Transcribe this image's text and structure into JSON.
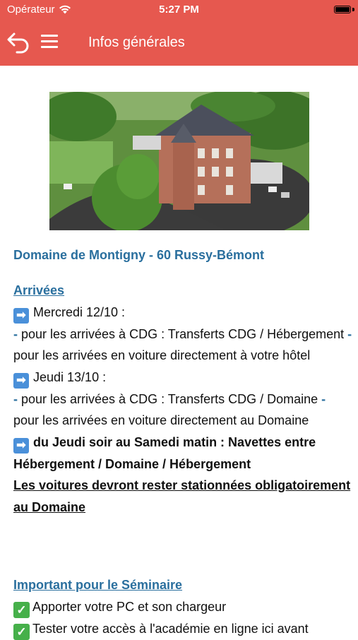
{
  "status_bar": {
    "carrier": "Opérateur",
    "time": "5:27 PM"
  },
  "navbar": {
    "title": "Infos générales",
    "back_icon": "back-arrow-icon",
    "menu_icon": "hamburger-menu-icon"
  },
  "colors": {
    "accent": "#e6584f",
    "link": "#2a6f9e"
  },
  "venue_title": "Domaine de Montigny - 60 Russy-Bémont",
  "arrivals": {
    "heading": "Arrivées",
    "day1": "Mercredi 12/10 :",
    "day1_line1_dash": "-",
    "day1_line1": " pour les arrivées à CDG : Transferts CDG / Hébergement ",
    "day1_line2_dash": "-",
    "day1_line2": " pour les arrivées en voiture directement à votre hôtel",
    "day2": "Jeudi 13/10 :",
    "day2_line1_dash": "-",
    "day2_line1": " pour les arrivées à CDG : Transferts CDG / Domaine ",
    "day2_line2_dash": "-",
    "day2_line2": " pour les arrivées en voiture directement au Domaine",
    "shuttle": "du Jeudi soir au Samedi matin : Navettes entre Hébergement / Domaine / Hébergement",
    "parking": "Les voitures devront rester stationnées obligatoirement au Domaine"
  },
  "seminar": {
    "heading": "Important pour le Séminaire",
    "item1": "Apporter votre PC et son chargeur",
    "item2": "Tester votre accès à l'académie en ligne ici avant"
  }
}
